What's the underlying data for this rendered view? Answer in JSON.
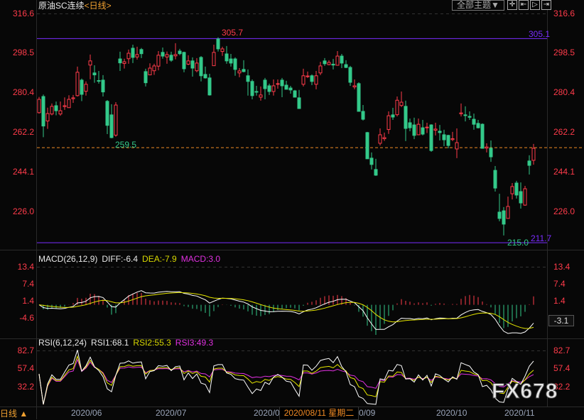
{
  "header": {
    "instrument": "原油SC连续",
    "timeframe": "<日线>",
    "theme_button": "全部主题▼",
    "tools": [
      {
        "icon": "crosshair-icon",
        "glyph": "✛"
      },
      {
        "icon": "fit-range-icon",
        "glyph": "⇤"
      },
      {
        "icon": "play-forward-icon",
        "glyph": "▷"
      },
      {
        "icon": "scroll-end-icon",
        "glyph": "⇥"
      }
    ]
  },
  "colors": {
    "up": "#ff3b4a",
    "down": "#33c98a",
    "axis_label": "#ff3b4a",
    "ref_line": "#7a2cff",
    "last_price_line": "#f08a24",
    "diff": "#ffffff",
    "dea": "#e6e600",
    "rsi1": "#ffffff",
    "rsi2": "#e6e600",
    "rsi3": "#e030e0"
  },
  "chart_data": {
    "type": "candlestick",
    "title": "原油SC连续 <日线>",
    "price_axis": {
      "ticks": [
        "316.6",
        "298.5",
        "280.4",
        "262.2",
        "244.1",
        "226.0"
      ],
      "range": [
        226.0,
        316.6
      ]
    },
    "annotations": {
      "high": "305.7",
      "low_left": "259.5",
      "low": "215.0",
      "ref_high": "305.1",
      "ref_low": "211.7"
    },
    "ref_lines": [
      305.1,
      211.7
    ],
    "last_price": 255.2,
    "ohlc": [
      [
        271.2,
        278.4,
        270.8,
        277.3
      ],
      [
        278.6,
        279.5,
        260.0,
        265.1
      ],
      [
        267.4,
        273.5,
        263.8,
        270.8
      ],
      [
        270.6,
        275.4,
        270.0,
        274.1
      ],
      [
        274.4,
        276.3,
        270.0,
        272.1
      ],
      [
        270.6,
        276.3,
        269.8,
        272.1
      ],
      [
        274.0,
        278.2,
        272.5,
        274.4
      ],
      [
        273.5,
        279.2,
        273.5,
        277.3
      ],
      [
        277.6,
        279.3,
        275.7,
        278.0
      ],
      [
        279.0,
        292.3,
        278.6,
        289.7
      ],
      [
        286.1,
        286.8,
        276.5,
        279.6
      ],
      [
        281.0,
        285.5,
        279.0,
        284.2
      ],
      [
        293.0,
        297.8,
        286.5,
        294.9
      ],
      [
        289.4,
        292.9,
        284.9,
        288.5
      ],
      [
        285.9,
        290.3,
        284.5,
        285.7
      ],
      [
        286.1,
        288.4,
        278.6,
        280.7
      ],
      [
        276.4,
        277.0,
        261.4,
        265.4
      ],
      [
        270.2,
        275.1,
        259.5,
        259.8
      ],
      [
        260.9,
        276.0,
        260.2,
        274.7
      ],
      [
        295.8,
        299.1,
        290.3,
        294.0
      ],
      [
        293.7,
        295.9,
        291.4,
        294.5
      ],
      [
        295.9,
        300.1,
        293.6,
        298.4
      ],
      [
        300.7,
        302.3,
        293.9,
        296.5
      ],
      [
        296.7,
        301.4,
        295.5,
        297.8
      ],
      [
        300.1,
        300.8,
        296.2,
        298.2
      ],
      [
        290.0,
        291.3,
        283.2,
        284.9
      ],
      [
        288.5,
        293.8,
        288.5,
        291.6
      ],
      [
        290.4,
        293.6,
        288.5,
        292.6
      ],
      [
        292.5,
        299.4,
        290.6,
        297.5
      ],
      [
        298.8,
        301.0,
        295.9,
        297.1
      ],
      [
        296.7,
        299.2,
        293.6,
        297.8
      ],
      [
        297.5,
        299.1,
        294.5,
        295.2
      ],
      [
        297.2,
        303.0,
        295.6,
        297.8
      ],
      [
        299.4,
        300.4,
        297.5,
        298.2
      ],
      [
        298.8,
        299.1,
        289.7,
        291.3
      ],
      [
        293.4,
        297.5,
        293.0,
        294.9
      ],
      [
        294.9,
        296.5,
        287.7,
        291.6
      ],
      [
        290.4,
        296.2,
        289.7,
        293.9
      ],
      [
        296.5,
        297.1,
        285.5,
        288.1
      ],
      [
        288.7,
        292.3,
        286.8,
        287.1
      ],
      [
        287.1,
        289.0,
        279.0,
        279.3
      ],
      [
        292.7,
        302.3,
        292.7,
        298.8
      ],
      [
        304.9,
        305.7,
        299.2,
        300.4
      ],
      [
        299.2,
        301.4,
        297.2,
        300.4
      ],
      [
        298.1,
        301.7,
        293.6,
        294.9
      ],
      [
        295.8,
        298.1,
        292.3,
        293.9
      ],
      [
        295.8,
        296.5,
        288.1,
        291.0
      ],
      [
        289.4,
        291.6,
        287.4,
        290.3
      ],
      [
        291.0,
        295.2,
        289.7,
        290.0
      ],
      [
        288.1,
        291.0,
        279.0,
        285.5
      ],
      [
        285.5,
        286.4,
        277.3,
        279.0
      ],
      [
        280.9,
        283.5,
        279.0,
        280.7
      ],
      [
        278.3,
        283.2,
        276.7,
        279.3
      ],
      [
        286.1,
        287.1,
        277.3,
        282.2
      ],
      [
        283.5,
        284.5,
        279.3,
        280.9
      ],
      [
        280.9,
        286.4,
        279.0,
        283.5
      ],
      [
        284.3,
        286.4,
        282.2,
        284.5
      ],
      [
        286.1,
        287.1,
        278.3,
        283.5
      ],
      [
        283.8,
        285.8,
        281.9,
        281.9
      ],
      [
        282.5,
        283.5,
        279.9,
        281.6
      ],
      [
        281.2,
        281.6,
        278.3,
        278.3
      ],
      [
        278.0,
        281.6,
        273.1,
        273.1
      ],
      [
        284.2,
        291.3,
        283.2,
        288.1
      ],
      [
        287.8,
        290.0,
        287.1,
        288.0
      ],
      [
        288.1,
        288.7,
        283.8,
        285.5
      ],
      [
        284.2,
        290.3,
        281.9,
        288.1
      ],
      [
        289.4,
        294.5,
        288.4,
        292.6
      ],
      [
        294.9,
        296.2,
        292.6,
        293.6
      ],
      [
        293.2,
        295.2,
        292.9,
        294.2
      ],
      [
        293.4,
        295.8,
        291.0,
        293.0
      ],
      [
        292.9,
        299.4,
        292.9,
        297.1
      ],
      [
        297.1,
        298.1,
        291.6,
        293.9
      ],
      [
        293.2,
        295.2,
        291.6,
        291.9
      ],
      [
        291.9,
        292.6,
        283.5,
        285.1
      ],
      [
        283.0,
        286.4,
        281.9,
        283.5
      ],
      [
        284.5,
        285.1,
        271.8,
        271.8
      ],
      [
        271.8,
        274.7,
        267.6,
        268.2
      ],
      [
        262.1,
        262.4,
        250.1,
        250.1
      ],
      [
        250.4,
        253.0,
        245.2,
        247.5
      ],
      [
        245.2,
        250.1,
        242.3,
        242.6
      ],
      [
        257.2,
        264.0,
        256.2,
        261.1
      ],
      [
        259.3,
        262.1,
        258.3,
        259.8
      ],
      [
        263.5,
        271.8,
        261.5,
        269.8
      ],
      [
        270.2,
        273.4,
        267.9,
        269.2
      ],
      [
        270.3,
        278.6,
        269.5,
        276.9
      ],
      [
        274.5,
        280.9,
        273.8,
        276.0
      ],
      [
        274.1,
        276.7,
        258.2,
        264.0
      ],
      [
        266.6,
        268.5,
        262.7,
        264.3
      ],
      [
        265.6,
        268.9,
        259.1,
        260.8
      ],
      [
        261.1,
        268.5,
        261.1,
        265.9
      ],
      [
        264.3,
        267.9,
        260.8,
        261.4
      ],
      [
        264.4,
        266.6,
        261.9,
        264.6
      ],
      [
        265.6,
        265.9,
        253.3,
        253.9
      ],
      [
        263.2,
        266.6,
        260.8,
        263.7
      ],
      [
        262.7,
        265.6,
        258.5,
        262.1
      ],
      [
        261.1,
        263.4,
        255.9,
        258.8
      ],
      [
        260.8,
        261.1,
        254.9,
        256.2
      ],
      [
        258.9,
        262.4,
        258.2,
        259.3
      ],
      [
        254.6,
        264.0,
        250.4,
        257.5
      ],
      [
        270.7,
        275.4,
        269.5,
        271.1
      ],
      [
        270.2,
        274.1,
        267.2,
        270.0
      ],
      [
        269.5,
        271.8,
        267.9,
        269.1
      ],
      [
        268.2,
        270.8,
        263.4,
        265.9
      ],
      [
        266.3,
        267.9,
        264.0,
        264.3
      ],
      [
        265.9,
        266.3,
        254.9,
        254.9
      ],
      [
        255.0,
        257.2,
        253.0,
        255.5
      ],
      [
        254.9,
        258.5,
        248.7,
        251.0
      ],
      [
        244.8,
        246.8,
        235.1,
        236.7
      ],
      [
        225.7,
        234.1,
        221.5,
        222.8
      ],
      [
        226.3,
        228.0,
        215.0,
        220.2
      ],
      [
        222.8,
        232.8,
        222.8,
        228.3
      ],
      [
        234.1,
        239.0,
        231.5,
        237.4
      ],
      [
        239.0,
        240.0,
        231.9,
        233.5
      ],
      [
        235.1,
        239.3,
        227.3,
        229.9
      ],
      [
        228.9,
        237.7,
        228.6,
        236.4
      ],
      [
        249.1,
        251.7,
        242.9,
        247.1
      ],
      [
        249.4,
        256.9,
        247.4,
        254.9
      ]
    ],
    "x_axis": {
      "ticks": [
        "2020/06",
        "2020/07",
        "2020/0",
        "0/09",
        "2020/10",
        "2020/11"
      ],
      "cursor_date": "2020/08/11 星期二"
    },
    "macd": {
      "label": "MACD(26,12,9)",
      "diff": "DIFF:-6.4",
      "dea": "DEA:-7.9",
      "macd": "MACD:3.0",
      "ticks": [
        "13.4",
        "7.4",
        "1.4",
        "-4.6"
      ],
      "cursor_value": "-3.1"
    },
    "rsi": {
      "label": "RSI(6,12,24)",
      "rsi1": "RSI1:68.1",
      "rsi2": "RSI2:55.3",
      "rsi3": "RSI3:49.3",
      "ticks": [
        "82.7",
        "57.4",
        "32.2"
      ]
    }
  },
  "footer": {
    "timeframe_toggle": "日线 ▲",
    "watermark": "FX678"
  }
}
